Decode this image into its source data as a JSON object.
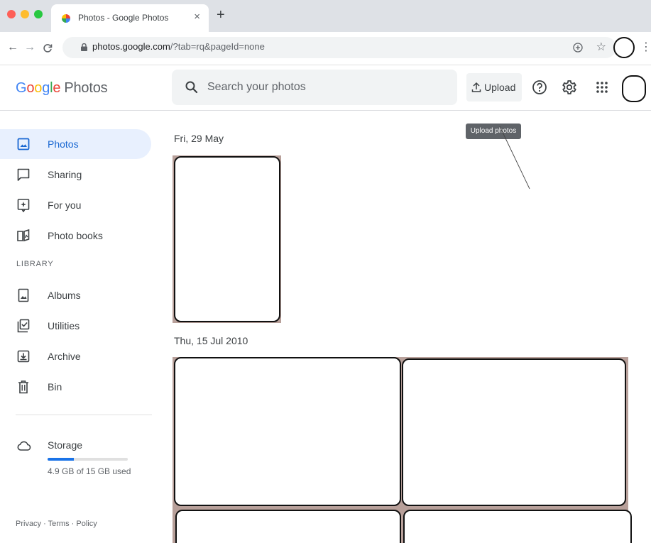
{
  "browser": {
    "tab_title": "Photos - Google Photos",
    "tab_close": "×",
    "new_tab": "+",
    "url_host": "photos.google.com",
    "url_path": "/?tab=rq&pageId=none"
  },
  "header": {
    "logo": {
      "letters": [
        "G",
        "o",
        "o",
        "g",
        "l",
        "e"
      ],
      "product": "Photos"
    },
    "search_placeholder": "Search your photos",
    "upload_label": "Upload",
    "upload_tooltip": "Upload photos"
  },
  "sidebar": {
    "items": [
      {
        "label": "Photos",
        "icon": "photo-icon",
        "active": true
      },
      {
        "label": "Sharing",
        "icon": "sharing-icon"
      },
      {
        "label": "For you",
        "icon": "for-you-icon"
      },
      {
        "label": "Photo books",
        "icon": "photo-books-icon"
      }
    ],
    "library_label": "LIBRARY",
    "library_items": [
      {
        "label": "Albums",
        "icon": "albums-icon"
      },
      {
        "label": "Utilities",
        "icon": "utilities-icon"
      },
      {
        "label": "Archive",
        "icon": "archive-icon"
      },
      {
        "label": "Bin",
        "icon": "bin-icon"
      }
    ],
    "storage": {
      "label": "Storage",
      "used_text": "4.9 GB of 15 GB used",
      "used_fraction": 0.33
    },
    "footer": {
      "privacy": "Privacy",
      "terms": "Terms",
      "policy": "Policy",
      "separator": "·"
    }
  },
  "main": {
    "groups": [
      {
        "date": "Fri, 29 May",
        "photo_count": 1
      },
      {
        "date": "Thu, 15 Jul 2010",
        "photo_count": 4
      }
    ]
  },
  "colors": {
    "accent": "#1a73e8",
    "active_bg": "#e8f0fe",
    "active_text": "#1967d2"
  }
}
